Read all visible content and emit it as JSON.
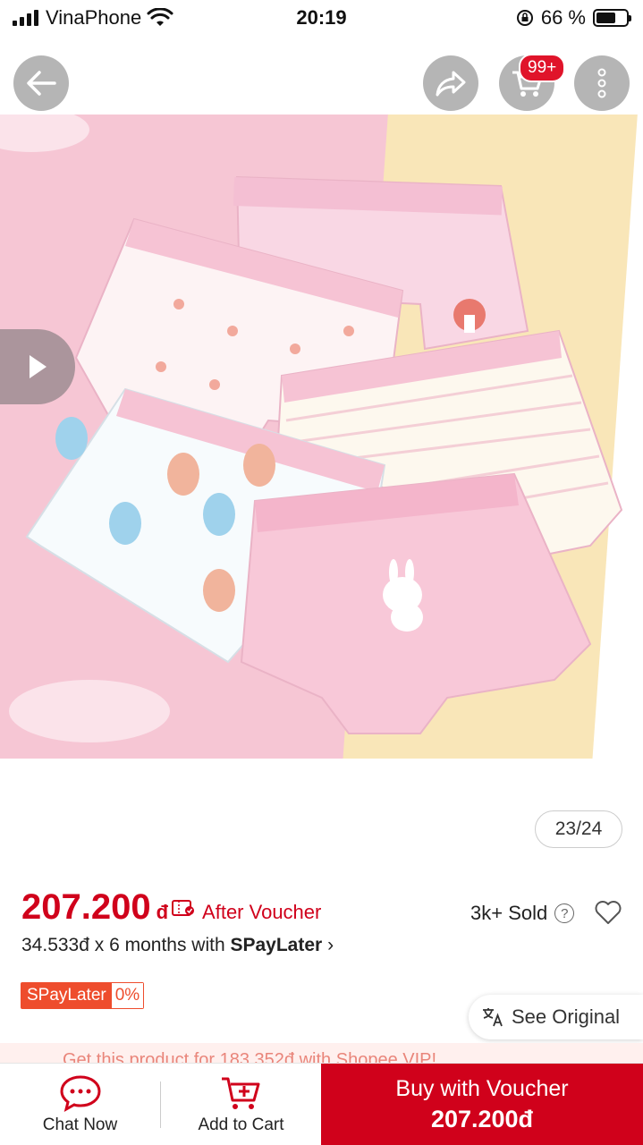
{
  "status_bar": {
    "carrier": "VinaPhone",
    "time": "20:19",
    "battery_percent": "66 %",
    "battery_level": 0.66
  },
  "header": {
    "cart_badge": "99+"
  },
  "gallery": {
    "counter": "23/24"
  },
  "product": {
    "price": "207.200",
    "currency": "đ",
    "after_voucher": "After Voucher",
    "sold": "3k+ Sold",
    "help": "?",
    "installment_prefix": "34.533đ x 6 months with ",
    "installment_brand": "SPayLater",
    "installment_chevron": "›",
    "spay_tag_label": "SPayLater",
    "spay_tag_rate": "0%"
  },
  "translate": {
    "label": "See Original"
  },
  "vip_strip": {
    "text": "Get this product for 183.352đ with Shopee VIP!"
  },
  "bottom_bar": {
    "chat_label": "Chat Now",
    "cart_label": "Add to Cart",
    "buy_label": "Buy with Voucher",
    "buy_price": "207.200đ"
  },
  "colors": {
    "brand_red": "#d0011b",
    "shopee_orange": "#ee4d2d"
  }
}
